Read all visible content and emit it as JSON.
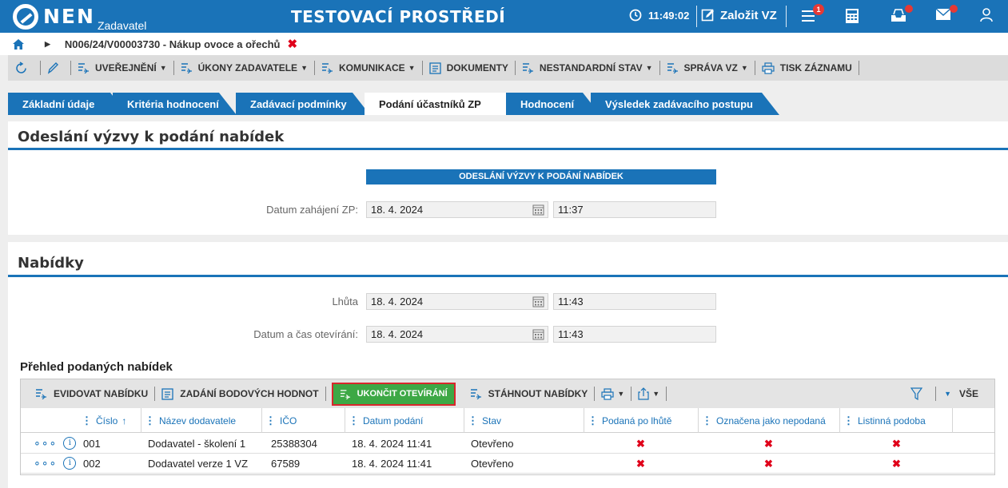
{
  "app": {
    "logo_text": "NEN",
    "logo_sub": "Zadavatel",
    "environment": "TESTOVACÍ PROSTŘEDÍ",
    "clock": "11:49:02",
    "create_label": "Založit VZ",
    "notification_count": "1"
  },
  "breadcrumb": {
    "path": "N006/24/V00003730 - Nákup ovoce a ořechů"
  },
  "toolbar": {
    "items": [
      {
        "label": "UVEŘEJNĚNÍ"
      },
      {
        "label": "ÚKONY ZADAVATELE"
      },
      {
        "label": "KOMUNIKACE"
      },
      {
        "label": "DOKUMENTY"
      },
      {
        "label": "NESTANDARDNÍ STAV"
      },
      {
        "label": "SPRÁVA VZ"
      },
      {
        "label": "TISK ZÁZNAMU"
      }
    ]
  },
  "tabs": [
    {
      "label": "Základní údaje"
    },
    {
      "label": "Kritéria hodnocení"
    },
    {
      "label": "Zadávací podmínky"
    },
    {
      "label": "Podání účastníků ZP"
    },
    {
      "label": "Hodnocení"
    },
    {
      "label": "Výsledek zadávacího postupu"
    }
  ],
  "invitation": {
    "title": "Odeslání výzvy k podání nabídek",
    "section_bar": "ODESLÁNÍ VÝZVY K PODÁNÍ NABÍDEK",
    "start_label": "Datum zahájení ZP:",
    "start_date": "18. 4. 2024",
    "start_time": "11:37"
  },
  "offers": {
    "title": "Nabídky",
    "deadline_label": "Lhůta",
    "deadline_date": "18. 4. 2024",
    "deadline_time": "11:43",
    "opening_label": "Datum a čas otevírání:",
    "opening_date": "18. 4. 2024",
    "opening_time": "11:43",
    "overview_title": "Přehled podaných nabídek"
  },
  "grid": {
    "actions": {
      "register": "EVIDOVAT NABÍDKU",
      "scores": "ZADÁNÍ BODOVÝCH HODNOT",
      "finish": "UKONČIT OTEVÍRÁNÍ",
      "download": "STÁHNOUT NABÍDKY",
      "all": "VŠE"
    },
    "columns": [
      "Číslo",
      "Název dodavatele",
      "IČO",
      "Datum podání",
      "Stav",
      "Podaná po lhůtě",
      "Označena jako nepodaná",
      "Listinná podoba"
    ],
    "sort_indicator": "↑",
    "rows": [
      {
        "number": "001",
        "supplier": "Dodavatel - školení 1",
        "ico": "25388304",
        "submitted": "18. 4. 2024 11:41",
        "state": "Otevřeno",
        "late": "✖",
        "marked": "✖",
        "paper": "✖"
      },
      {
        "number": "002",
        "supplier": "Dodavatel verze 1 VZ",
        "ico": "67589",
        "submitted": "18. 4. 2024 11:41",
        "state": "Otevřeno",
        "late": "✖",
        "marked": "✖",
        "paper": "✖"
      }
    ]
  },
  "colors": {
    "brand": "#1a73b8",
    "primary_action": "#3da845",
    "danger": "#e0001a"
  }
}
